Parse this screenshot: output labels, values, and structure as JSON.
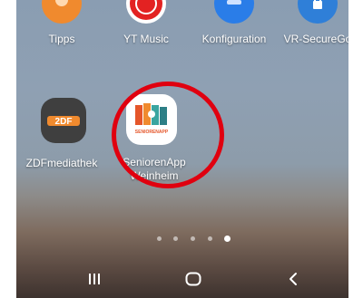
{
  "top_row": [
    {
      "label": "Tipps",
      "icon": "tipps-icon",
      "color": "#f08a2e"
    },
    {
      "label": "YT Music",
      "icon": "yt-music-icon",
      "color": "#e32222"
    },
    {
      "label": "Konfiguration",
      "icon": "konfiguration-icon",
      "color": "#2a7de8"
    },
    {
      "label": "VR-SecureGo",
      "icon": "vr-securego-icon",
      "color": "#2f7fd8"
    }
  ],
  "second_row": [
    {
      "label": "ZDFmediathek",
      "icon": "zdf-icon",
      "logo_text": "2DF",
      "color": "#f08a2e"
    },
    {
      "label": "SeniorenApp\nWeinheim",
      "icon": "seniorenapp-icon",
      "logo_text": "SENIORENAPP",
      "color": "#e5562a"
    }
  ],
  "page_indicator": {
    "count": 5,
    "active_index": 4
  },
  "navbar": {
    "recent": "recent-apps-icon",
    "home": "home-icon",
    "back": "back-icon"
  },
  "highlight": {
    "color": "#e0000f",
    "target": "SeniorenApp Weinheim"
  }
}
